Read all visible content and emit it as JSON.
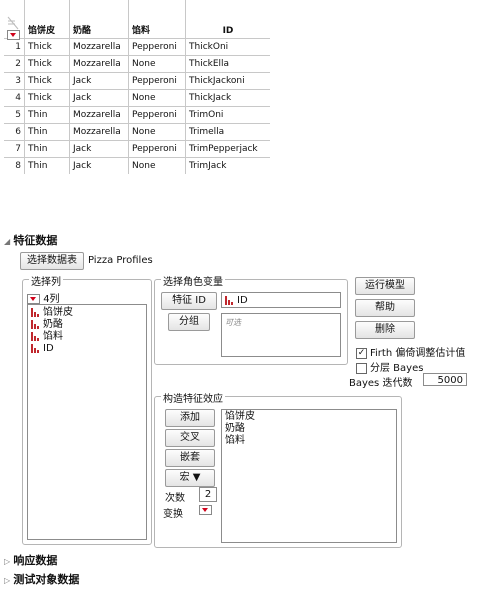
{
  "table": {
    "columns": [
      "馅饼皮",
      "奶酪",
      "馅料",
      "ID"
    ],
    "rows": [
      [
        "1",
        "Thick",
        "Mozzarella",
        "Pepperoni",
        "ThickOni"
      ],
      [
        "2",
        "Thick",
        "Mozzarella",
        "None",
        "ThickElla"
      ],
      [
        "3",
        "Thick",
        "Jack",
        "Pepperoni",
        "ThickJackoni"
      ],
      [
        "4",
        "Thick",
        "Jack",
        "None",
        "ThickJack"
      ],
      [
        "5",
        "Thin",
        "Mozzarella",
        "Pepperoni",
        "TrimOni"
      ],
      [
        "6",
        "Thin",
        "Mozzarella",
        "None",
        "Trimella"
      ],
      [
        "7",
        "Thin",
        "Jack",
        "Pepperoni",
        "TrimPepperjack"
      ],
      [
        "8",
        "Thin",
        "Jack",
        "None",
        "TrimJack"
      ]
    ]
  },
  "panel": {
    "title": "特征数据",
    "select_table_button": "选择数据表",
    "table_name": "Pizza Profiles",
    "select_columns_label": "选择列",
    "column_count": "4列",
    "columns": [
      "馅饼皮",
      "奶酪",
      "馅料",
      "ID"
    ],
    "roles_label": "选择角色变量",
    "feature_id_button": "特征 ID",
    "feature_id_value": "ID",
    "group_button": "分组",
    "group_placeholder": "可选",
    "run_button": "运行模型",
    "help_button": "帮助",
    "remove_button": "删除",
    "firth_label": "Firth 偏倚调整估计值",
    "firth_checked": true,
    "bayes_label": "分层 Bayes",
    "bayes_checked": false,
    "bayes_iter_label": "Bayes 迭代数",
    "bayes_iter_value": "5000",
    "effects_label": "构造特征效应",
    "add_button": "添加",
    "cross_button": "交叉",
    "nest_button": "嵌套",
    "macro_button": "宏 ▼",
    "degree_label": "次数",
    "degree_value": "2",
    "transform_label": "变换",
    "effects": [
      "馅饼皮",
      "奶酪",
      "馅料"
    ]
  },
  "collapsed_sections": [
    "响应数据",
    "测试对象数据"
  ],
  "colors": {
    "accent_red": "#c0272d"
  }
}
